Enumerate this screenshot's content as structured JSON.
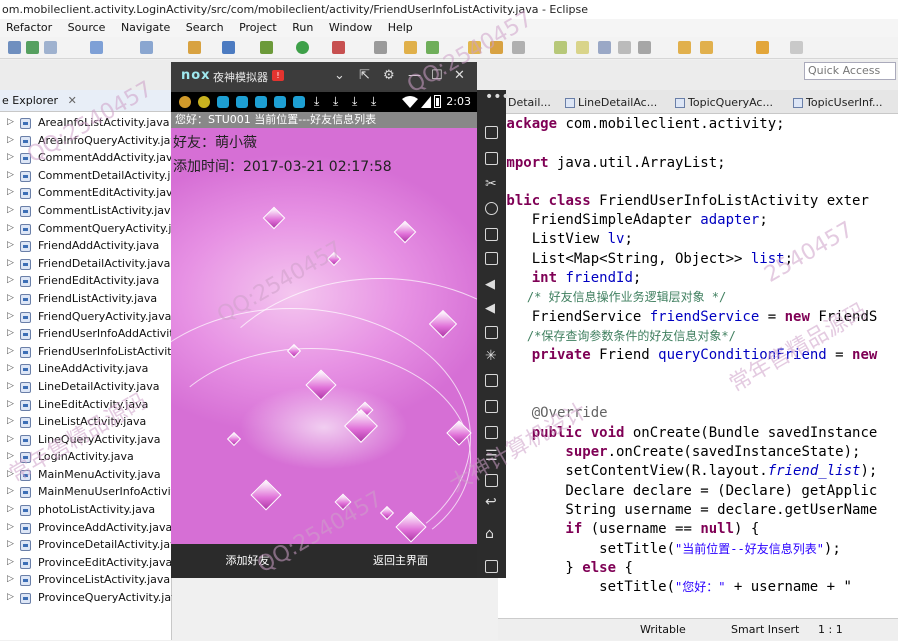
{
  "window": {
    "title": "om.mobileclient.activity.LoginActivity/src/com/mobileclient/activity/FriendUserInfoListActivity.java - Eclipse"
  },
  "menu": [
    "Refactor",
    "Source",
    "Navigate",
    "Search",
    "Project",
    "Run",
    "Window",
    "Help"
  ],
  "quick_access": {
    "placeholder": "Quick Access"
  },
  "package_explorer": {
    "tab_label": "e Explorer",
    "close": "✕",
    "files": [
      "AreaInfoListActivity.java",
      "AreaInfoQueryActivity.java",
      "CommentAddActivity.java",
      "CommentDetailActivity.java",
      "CommentEditActivity.java",
      "CommentListActivity.java",
      "CommentQueryActivity.java",
      "FriendAddActivity.java",
      "FriendDetailActivity.java",
      "FriendEditActivity.java",
      "FriendListActivity.java",
      "FriendQueryActivity.java",
      "FriendUserInfoAddActivity",
      "FriendUserInfoListActivity.j",
      "LineAddActivity.java",
      "LineDetailActivity.java",
      "LineEditActivity.java",
      "LineListActivity.java",
      "LineQueryActivity.java",
      "LoginActivity.java",
      "MainMenuActivity.java",
      "MainMenuUserInfoActivity",
      "photoListActivity.java",
      "ProvinceAddActivity.java",
      "ProvinceDetailActivity.java",
      "ProvinceEditActivity.java",
      "ProvinceListActivity.java",
      "ProvinceQueryActivity.java"
    ]
  },
  "editor": {
    "tabs": [
      "Detail...",
      "LineDetailAc...",
      "TopicQueryAc...",
      "TopicUserInf..."
    ],
    "code": {
      "l1_kw": "package",
      "l1_rest": " com.mobileclient.activity;",
      "l2_kw": "import",
      "l2_rest": " java.util.ArrayList;",
      "l3_kw1": "ublic",
      "l3_kw2": " class",
      "l3_rest": " FriendUserInfoListActivity exter",
      "l4_type": "    FriendSimpleAdapter ",
      "l4_fld": "adapter",
      "l4_end": ";",
      "l5_type": "    ListView ",
      "l5_fld": "lv",
      "l5_end": ";",
      "l6_type": "    List<Map<String, Object>> ",
      "l6_fld": "list",
      "l6_end": ";",
      "l7_kw": "    int",
      "l7_fld": " friendId",
      "l7_end": ";",
      "l8_cmt": "    /* 好友信息操作业务逻辑层对象 */",
      "l9_type": "    FriendService ",
      "l9_fld": "friendService",
      "l9_mid": " = ",
      "l9_kw": "new",
      "l9_end": " FriendS",
      "l10_cmt": "    /*保存查询参数条件的好友信息对象*/",
      "l11_kw": "    private",
      "l11_type": " Friend ",
      "l11_fld": "queryConditionFriend",
      "l11_mid": " = ",
      "l11_kw2": "new",
      "l12_ann": "    @Override",
      "l13_kw": "    public void",
      "l13_rest": " onCreate(Bundle savedInstance",
      "l14_kw": "        super",
      "l14_rest": ".onCreate(savedInstanceState);",
      "l15_pre": "        setContentView(R.layout.",
      "l15_ital": "friend_list",
      "l15_end": ");",
      "l16": "        Declare declare = (Declare) getApplic",
      "l17": "        String username = declare.getUserName",
      "l18_kw": "        if",
      "l18_mid": " (username == ",
      "l18_kw2": "null",
      "l18_end": ") {",
      "l19_pre": "            setTitle(",
      "l19_str": "\"当前位置--好友信息列表\"",
      "l19_end": ");",
      "l20_pre": "        } ",
      "l20_kw": "else",
      "l20_end": " {",
      "l21_pre": "            setTitle(",
      "l21_str": "\"您好：\"",
      "l21_end": " + username + \""
    }
  },
  "status_bar": {
    "mode": "Writable",
    "insert": "Smart Insert",
    "position": "1 : 1"
  },
  "emulator": {
    "logo": "nox",
    "title": "夜神模拟器",
    "badge": "!",
    "controls": {
      "menu": "⌄",
      "pin": "⇱",
      "settings": "⚙",
      "minimize": "—",
      "maximize": "☐",
      "close": "✕"
    },
    "status_time": "2:03",
    "app_header": "您好：STU001  当前位置---好友信息列表",
    "friend_label": "好友：萌小薇",
    "add_time_label": "添加时间：2017-03-21 02:17:58",
    "add_friend_button": "添加好友",
    "return_button": "返回主界面"
  },
  "watermark": {
    "qq": "QQ:2540457",
    "qq_partial": "2540457",
    "phrase1": "常年售精品源码",
    "phrase2": "大神计算机设计"
  },
  "colors": {
    "keyword": "#7f0055",
    "field": "#0000c0",
    "comment": "#3f7f5f",
    "string": "#2a00ff",
    "app_background": "#e792e4"
  }
}
